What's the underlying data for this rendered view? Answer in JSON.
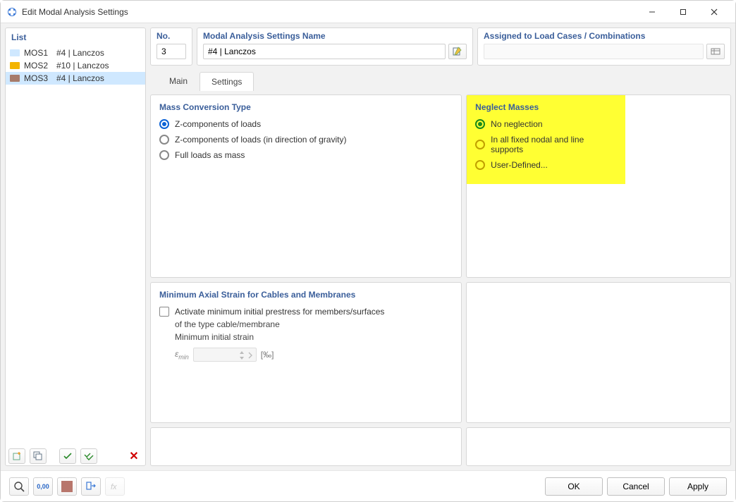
{
  "window": {
    "title": "Edit Modal Analysis Settings"
  },
  "list": {
    "header": "List",
    "items": [
      {
        "id": "MOS1",
        "label": "#4 | Lanczos",
        "color": "#cfe8ff"
      },
      {
        "id": "MOS2",
        "label": "#10 | Lanczos",
        "color": "#f3b400"
      },
      {
        "id": "MOS3",
        "label": "#4 | Lanczos",
        "color": "#a77b6a"
      }
    ]
  },
  "no": {
    "label": "No.",
    "value": "3"
  },
  "name": {
    "label": "Modal Analysis Settings Name",
    "value": "#4 | Lanczos"
  },
  "assigned": {
    "label": "Assigned to Load Cases / Combinations"
  },
  "tabs": {
    "main": "Main",
    "settings": "Settings"
  },
  "mass_conv": {
    "title": "Mass Conversion Type",
    "opt1": "Z-components of loads",
    "opt2": "Z-components of loads (in direction of gravity)",
    "opt3": "Full loads as mass"
  },
  "neglect": {
    "title": "Neglect Masses",
    "opt1": "No neglection",
    "opt2": "In all fixed nodal and line supports",
    "opt3": "User-Defined..."
  },
  "min_strain": {
    "title": "Minimum Axial Strain for Cables and Membranes",
    "check_label_line1": "Activate minimum initial prestress for members/surfaces",
    "check_label_line2": "of the type cable/membrane",
    "sub_label": "Minimum initial strain",
    "symbol_main": "ε",
    "symbol_sub": "min",
    "unit": "[‰]"
  },
  "footer": {
    "ok": "OK",
    "cancel": "Cancel",
    "apply": "Apply"
  },
  "colors": {
    "swatch": "#b8766c"
  }
}
